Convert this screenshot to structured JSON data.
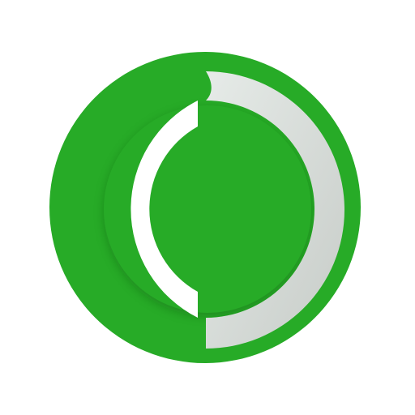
{
  "icon": {
    "name": "circular-arrows-app-icon",
    "colors": {
      "background": "#ffffff",
      "ring": "#27ab27",
      "inner_disc": "#27ab27",
      "left_arc": "#ffffff",
      "right_arc_light": "#e6ebe8",
      "right_arc_dark": "#c7ccc8",
      "shadow": "#0f4d0f"
    }
  }
}
